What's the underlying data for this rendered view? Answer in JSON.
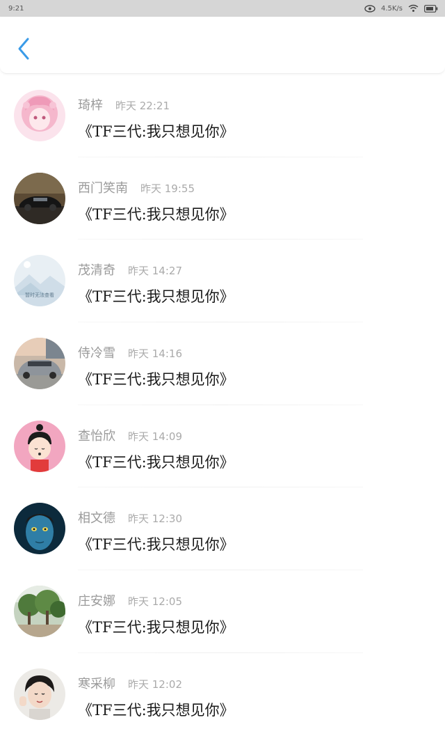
{
  "status_bar": {
    "time": "9:21",
    "net_speed": "4.5K/s"
  },
  "header": {
    "back_icon": "chevron-left-icon",
    "accent_color": "#3a9be8"
  },
  "comments": [
    {
      "name": "琦梓",
      "time": "昨天 22:21",
      "text": "《TF三代:我只想见你》",
      "avatar": "anime-girl-avatar"
    },
    {
      "name": "西门笑南",
      "time": "昨天 19:55",
      "text": "《TF三代:我只想见你》",
      "avatar": "black-car-avatar"
    },
    {
      "name": "茂清奇",
      "time": "昨天 14:27",
      "text": "《TF三代:我只想见你》",
      "avatar": "placeholder-avatar",
      "placeholder_label": "暂时无法查看"
    },
    {
      "name": "侍冷雪",
      "time": "昨天 14:16",
      "text": "《TF三代:我只想见你》",
      "avatar": "silver-car-avatar"
    },
    {
      "name": "查怡欣",
      "time": "昨天 14:09",
      "text": "《TF三代:我只想见你》",
      "avatar": "cartoon-girl-avatar"
    },
    {
      "name": "相文德",
      "time": "昨天 12:30",
      "text": "《TF三代:我只想见你》",
      "avatar": "blue-face-avatar"
    },
    {
      "name": "庄安娜",
      "time": "昨天 12:05",
      "text": "《TF三代:我只想见你》",
      "avatar": "trees-avatar"
    },
    {
      "name": "寒采柳",
      "time": "昨天 12:02",
      "text": "《TF三代:我只想见你》",
      "avatar": "boy-avatar"
    }
  ]
}
